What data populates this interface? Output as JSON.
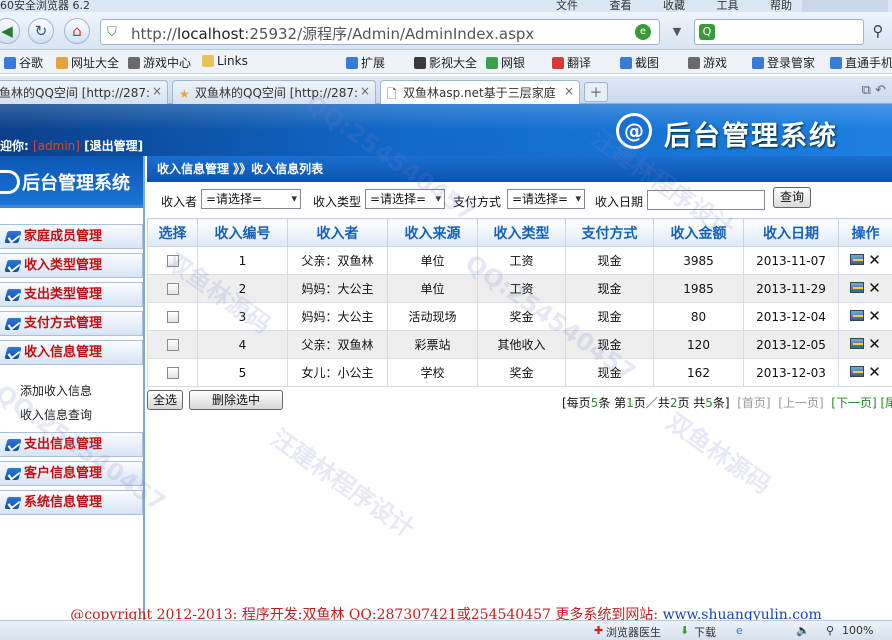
{
  "browser": {
    "title": "60安全浏览器 6.2",
    "menus": [
      "文件",
      "查看",
      "收藏",
      "工具",
      "帮助"
    ],
    "url_prefix": "http://",
    "url_host": "localhost",
    "url_rest": ":25932/源程序/Admin/AdminIndex.aspx",
    "search_placeholder": ""
  },
  "favorites": [
    {
      "label": "谷歌",
      "color": "#3a7bd5"
    },
    {
      "label": "网址大全",
      "color": "#e8a23a"
    },
    {
      "label": "游戏中心",
      "color": "#6a6a6a"
    },
    {
      "label": "Links",
      "color": "#e8c35a"
    },
    {
      "label": "扩展",
      "color": "#3a7bd5"
    },
    {
      "label": "影视大全",
      "color": "#3a3a3a"
    },
    {
      "label": "网银",
      "color": "#3aa34a"
    },
    {
      "label": "翻译",
      "color": "#d43a3a"
    },
    {
      "label": "截图",
      "color": "#3a7bd5"
    },
    {
      "label": "游戏",
      "color": "#6a6a6a"
    },
    {
      "label": "登录管家",
      "color": "#3a7bd5"
    },
    {
      "label": "直通手机",
      "color": "#3a7bd5"
    }
  ],
  "tabs": [
    {
      "label": "鱼林的QQ空间 [http://287:"
    },
    {
      "label": "双鱼林的QQ空间 [http://287:"
    },
    {
      "label": "双鱼林asp.net基于三层家庭"
    }
  ],
  "banner": {
    "title": "后台管理系统",
    "welcome": "迎你:",
    "username": "[admin]",
    "logout": "[退出管理]"
  },
  "sidebar": {
    "title": "后台管理系统",
    "items": [
      {
        "label": "家庭成员管理"
      },
      {
        "label": "收入类型管理"
      },
      {
        "label": "支出类型管理"
      },
      {
        "label": "支付方式管理"
      },
      {
        "label": "收入信息管理"
      }
    ],
    "submenu": [
      {
        "label": "添加收入信息"
      },
      {
        "label": "收入信息查询"
      }
    ],
    "items2": [
      {
        "label": "支出信息管理"
      },
      {
        "label": "客户信息管理"
      },
      {
        "label": "系统信息管理"
      }
    ]
  },
  "breadcrumb": "收入信息管理 》》收入信息列表",
  "filter": {
    "payer_label": "收入者",
    "payer_value": "=请选择=",
    "type_label": "收入类型",
    "type_value": "=请选择=",
    "pay_label": "支付方式",
    "pay_value": "=请选择=",
    "date_label": "收入日期",
    "query": "查询"
  },
  "table": {
    "headers": [
      "选择",
      "收入编号",
      "收入者",
      "收入来源",
      "收入类型",
      "支付方式",
      "收入金额",
      "收入日期",
      "操作"
    ],
    "rows": [
      {
        "id": "1",
        "payer": "父亲：双鱼林",
        "source": "单位",
        "type": "工资",
        "pay": "现金",
        "amount": "3985",
        "date": "2013-11-07"
      },
      {
        "id": "2",
        "payer": "妈妈：大公主",
        "source": "单位",
        "type": "工资",
        "pay": "现金",
        "amount": "1985",
        "date": "2013-11-29"
      },
      {
        "id": "3",
        "payer": "妈妈：大公主",
        "source": "活动现场",
        "type": "奖金",
        "pay": "现金",
        "amount": "80",
        "date": "2013-12-04"
      },
      {
        "id": "4",
        "payer": "父亲：双鱼林",
        "source": "彩票站",
        "type": "其他收入",
        "pay": "现金",
        "amount": "120",
        "date": "2013-12-05"
      },
      {
        "id": "5",
        "payer": "女儿：小公主",
        "source": "学校",
        "type": "奖金",
        "pay": "现金",
        "amount": "162",
        "date": "2013-12-03"
      }
    ]
  },
  "actions": {
    "select_all": "全选",
    "delete_selected": "删除选中"
  },
  "pager": {
    "per_page_prefix": "[每页",
    "per_page": "5",
    "per_page_suffix": "条 第",
    "page": "1",
    "page_mid": "页／共",
    "total_pages": "2",
    "pages_suffix": "页 共",
    "total": "5",
    "total_suffix": "条]",
    "first": "[首页]",
    "prev": "[上一页]",
    "next": "[下一页]",
    "last": "[尾页"
  },
  "footer": {
    "text": "@copyright 2012-2013: 程序开发:双鱼林  QQ:287307421或254540457  更多系统到网站: ",
    "site": "www.shuangyulin.com"
  },
  "statusbar": {
    "doctor": "浏览器医生",
    "download": "下载",
    "zoom": "100%"
  },
  "watermarks": [
    "汪建林程序设计",
    "QQ:254540457",
    "双鱼林源码"
  ]
}
